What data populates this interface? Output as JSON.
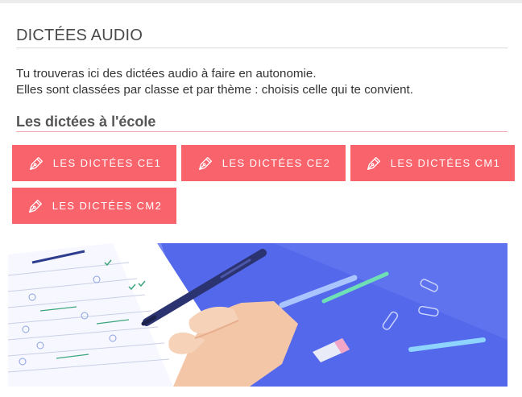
{
  "page": {
    "title": "DICTÉES AUDIO",
    "intro_line1": "Tu trouveras ici des dictées audio à faire en autonomie.",
    "intro_line2": "Elles sont classées par classe et par thème : choisis celle qui te convient."
  },
  "section": {
    "title": "Les dictées à l'école",
    "buttons": [
      {
        "label": "LES DICTÉES CE1",
        "icon": "pen-nib-icon"
      },
      {
        "label": "LES DICTÉES CE2",
        "icon": "pen-nib-icon"
      },
      {
        "label": "LES DICTÉES CM1",
        "icon": "pen-nib-icon"
      },
      {
        "label": "LES DICTÉES CM2",
        "icon": "pen-nib-icon"
      }
    ]
  },
  "colors": {
    "button_bg": "#f9636c",
    "illustration_bg": "#5468ec",
    "accent_rule": "#f2a8ad"
  }
}
